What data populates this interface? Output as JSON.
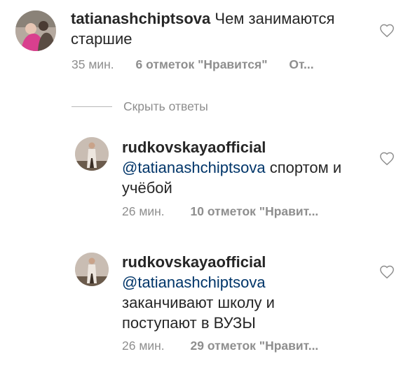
{
  "comments": [
    {
      "username": "tatianashchiptsova",
      "mention": "",
      "text_line1": "Чем занимаются",
      "text_lines": [
        "старшие"
      ],
      "time": "35 мин.",
      "likes": "6 отметок \"Нравится\"",
      "reply": "От..."
    },
    {
      "username": "rudkovskayaofficial",
      "mention": "@tatianashchiptsova",
      "text_line1": " спортом и",
      "text_lines": [
        "учёбой"
      ],
      "time": "26 мин.",
      "likes": "10 отметок \"Нравит..."
    },
    {
      "username": "rudkovskayaofficial",
      "mention": "@tatianashchiptsova",
      "text_line1": "",
      "text_lines": [
        "заканчивают школу и",
        "поступают в ВУЗЫ"
      ],
      "time": "26 мин.",
      "likes": "29 отметок \"Нравит..."
    }
  ],
  "hide_replies_label": "Скрыть ответы",
  "icons": {
    "like": "heart-outline-icon",
    "avatar_color": "#d8d2cf"
  }
}
